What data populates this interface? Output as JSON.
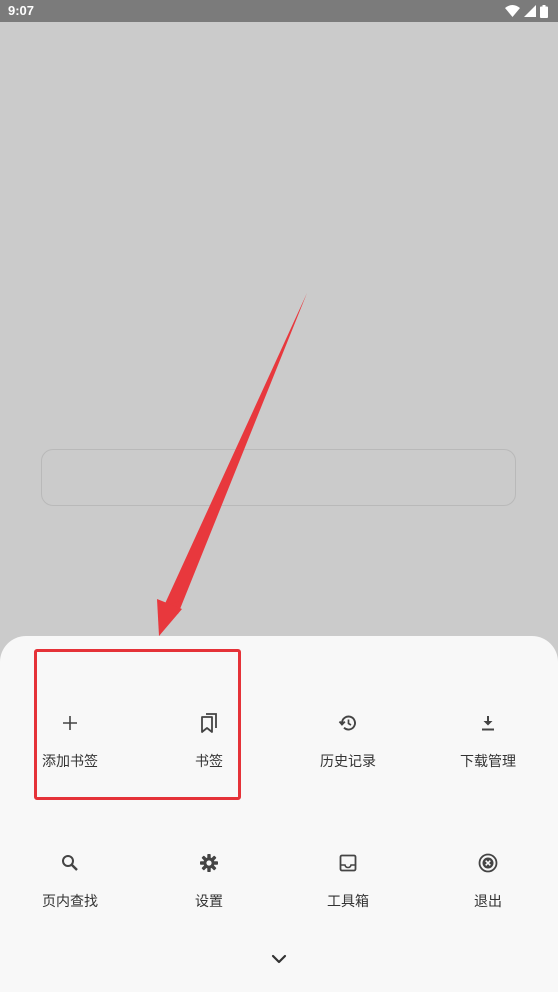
{
  "status_bar": {
    "time": "9:07",
    "icons": [
      "wifi-icon",
      "cellular-signal-icon",
      "battery-icon"
    ]
  },
  "menu": {
    "items": [
      {
        "label": "添加书签",
        "icon": "plus-icon"
      },
      {
        "label": "书签",
        "icon": "bookmarks-icon"
      },
      {
        "label": "历史记录",
        "icon": "history-icon"
      },
      {
        "label": "下载管理",
        "icon": "download-icon"
      },
      {
        "label": "页内查找",
        "icon": "search-icon"
      },
      {
        "label": "设置",
        "icon": "gear-icon"
      },
      {
        "label": "工具箱",
        "icon": "inbox-tray-icon"
      },
      {
        "label": "退出",
        "icon": "exit-circle-x-icon"
      }
    ],
    "collapse_icon": "chevron-down-icon"
  },
  "annotation": {
    "highlight_color": "#e53238",
    "arrow_color": "#e8383d"
  },
  "colors": {
    "backdrop": "#cbcbcb",
    "status_bar": "#7b7b7b",
    "sheet": "#f8f8f8",
    "text": "#333333",
    "icon": "#444444"
  }
}
